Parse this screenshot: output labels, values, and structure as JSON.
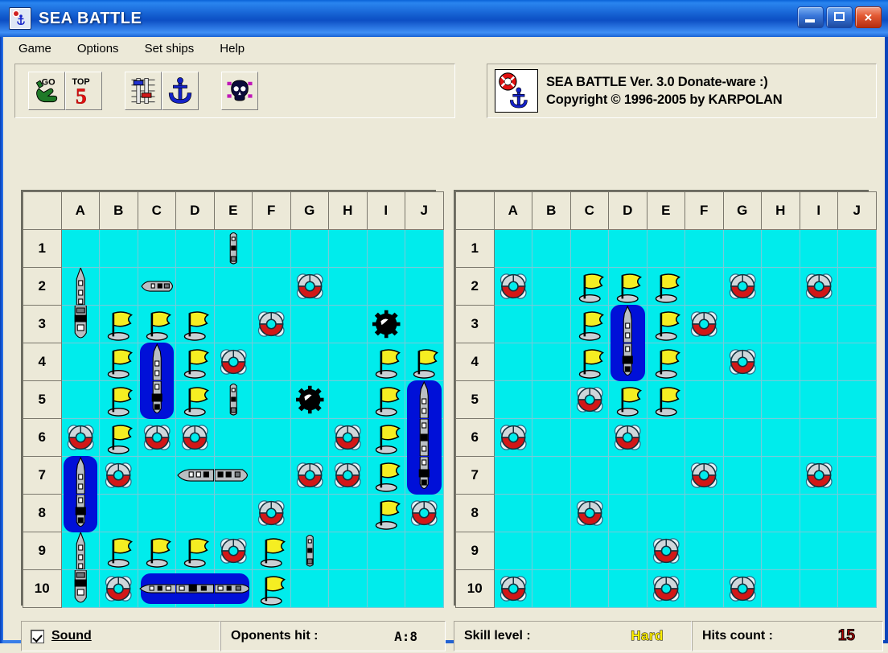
{
  "window": {
    "title": "SEA BATTLE",
    "icon": "seabattle-app-icon",
    "minimize_label": "",
    "maximize_label": "",
    "close_label": "✕"
  },
  "menu": {
    "items": [
      {
        "label": "Game"
      },
      {
        "label": "Options"
      },
      {
        "label": "Set ships"
      },
      {
        "label": "Help"
      }
    ]
  },
  "toolbar": {
    "buttons": [
      {
        "name": "go-button",
        "icon": "hand-go-icon",
        "label": "GO"
      },
      {
        "name": "top5-button",
        "icon": "top5-icon",
        "label": "TOP 5"
      },
      {
        "name": "options-button",
        "icon": "sliders-icon",
        "label": ""
      },
      {
        "name": "set-ships-button",
        "icon": "anchor-icon",
        "label": ""
      },
      {
        "name": "new-game-button",
        "icon": "skull-icon",
        "label": ""
      }
    ]
  },
  "about": {
    "icon": "lifering-anchor-icon",
    "line1": "SEA BATTLE Ver. 3.0  Donate-ware :)",
    "line2": "Copyright © 1996-2005 by KARPOLAN"
  },
  "boards": {
    "columns": [
      "A",
      "B",
      "C",
      "D",
      "E",
      "F",
      "G",
      "H",
      "I",
      "J"
    ],
    "rows": [
      "1",
      "2",
      "3",
      "4",
      "5",
      "6",
      "7",
      "8",
      "9",
      "10"
    ],
    "player": {
      "name": "player-board",
      "cells": [
        {
          "col": "E",
          "row": "1",
          "type": "ship",
          "shape": "small-vertical"
        },
        {
          "col": "A",
          "row": "2",
          "type": "ship",
          "shape": "tall-top"
        },
        {
          "col": "C",
          "row": "2",
          "type": "ship",
          "shape": "small-horizontal"
        },
        {
          "col": "G",
          "row": "2",
          "type": "hit"
        },
        {
          "col": "A",
          "row": "3",
          "type": "ship",
          "shape": "tall-bottom"
        },
        {
          "col": "B",
          "row": "3",
          "type": "miss"
        },
        {
          "col": "C",
          "row": "3",
          "type": "miss"
        },
        {
          "col": "D",
          "row": "3",
          "type": "miss"
        },
        {
          "col": "F",
          "row": "3",
          "type": "hit"
        },
        {
          "col": "I",
          "row": "3",
          "type": "mine"
        },
        {
          "col": "B",
          "row": "4",
          "type": "miss"
        },
        {
          "col": "C",
          "row": "4",
          "type": "sunk",
          "orient": "v-top"
        },
        {
          "col": "D",
          "row": "4",
          "type": "miss"
        },
        {
          "col": "E",
          "row": "4",
          "type": "hit"
        },
        {
          "col": "I",
          "row": "4",
          "type": "miss"
        },
        {
          "col": "J",
          "row": "4",
          "type": "miss"
        },
        {
          "col": "B",
          "row": "5",
          "type": "miss"
        },
        {
          "col": "C",
          "row": "5",
          "type": "sunk",
          "orient": "v-bot"
        },
        {
          "col": "D",
          "row": "5",
          "type": "miss"
        },
        {
          "col": "E",
          "row": "5",
          "type": "ship",
          "shape": "small-vertical"
        },
        {
          "col": "G",
          "row": "5",
          "type": "mine"
        },
        {
          "col": "I",
          "row": "5",
          "type": "miss"
        },
        {
          "col": "J",
          "row": "5",
          "type": "sunk",
          "orient": "v-top"
        },
        {
          "col": "A",
          "row": "6",
          "type": "hit"
        },
        {
          "col": "B",
          "row": "6",
          "type": "miss"
        },
        {
          "col": "C",
          "row": "6",
          "type": "hit"
        },
        {
          "col": "D",
          "row": "6",
          "type": "hit"
        },
        {
          "col": "H",
          "row": "6",
          "type": "hit"
        },
        {
          "col": "I",
          "row": "6",
          "type": "miss"
        },
        {
          "col": "J",
          "row": "6",
          "type": "sunk",
          "orient": "v-mid"
        },
        {
          "col": "A",
          "row": "7",
          "type": "sunk",
          "orient": "v-top"
        },
        {
          "col": "B",
          "row": "7",
          "type": "hit"
        },
        {
          "col": "D",
          "row": "7",
          "type": "ship",
          "shape": "long-horizontal"
        },
        {
          "col": "E",
          "row": "7",
          "type": "ship",
          "shape": "long-horizontal-tail"
        },
        {
          "col": "G",
          "row": "7",
          "type": "hit"
        },
        {
          "col": "H",
          "row": "7",
          "type": "hit"
        },
        {
          "col": "I",
          "row": "7",
          "type": "miss"
        },
        {
          "col": "J",
          "row": "7",
          "type": "sunk",
          "orient": "v-bot"
        },
        {
          "col": "A",
          "row": "8",
          "type": "sunk",
          "orient": "v-bot"
        },
        {
          "col": "F",
          "row": "8",
          "type": "hit"
        },
        {
          "col": "I",
          "row": "8",
          "type": "miss"
        },
        {
          "col": "J",
          "row": "8",
          "type": "hit"
        },
        {
          "col": "A",
          "row": "9",
          "type": "ship",
          "shape": "tall-top"
        },
        {
          "col": "B",
          "row": "9",
          "type": "miss"
        },
        {
          "col": "C",
          "row": "9",
          "type": "miss"
        },
        {
          "col": "D",
          "row": "9",
          "type": "miss"
        },
        {
          "col": "E",
          "row": "9",
          "type": "hit"
        },
        {
          "col": "F",
          "row": "9",
          "type": "miss"
        },
        {
          "col": "G",
          "row": "9",
          "type": "ship",
          "shape": "small-vertical"
        },
        {
          "col": "A",
          "row": "10",
          "type": "ship",
          "shape": "tall-bottom"
        },
        {
          "col": "B",
          "row": "10",
          "type": "hit"
        },
        {
          "col": "C",
          "row": "10",
          "type": "sunk",
          "orient": "h-left"
        },
        {
          "col": "D",
          "row": "10",
          "type": "sunk",
          "orient": "h-mid"
        },
        {
          "col": "E",
          "row": "10",
          "type": "sunk",
          "orient": "h-right"
        },
        {
          "col": "F",
          "row": "10",
          "type": "miss"
        }
      ]
    },
    "opponent": {
      "name": "opponent-board",
      "cells": [
        {
          "col": "A",
          "row": "2",
          "type": "hit"
        },
        {
          "col": "C",
          "row": "2",
          "type": "miss"
        },
        {
          "col": "D",
          "row": "2",
          "type": "miss"
        },
        {
          "col": "E",
          "row": "2",
          "type": "miss"
        },
        {
          "col": "G",
          "row": "2",
          "type": "hit"
        },
        {
          "col": "I",
          "row": "2",
          "type": "hit"
        },
        {
          "col": "C",
          "row": "3",
          "type": "miss"
        },
        {
          "col": "D",
          "row": "3",
          "type": "sunk",
          "orient": "v-top"
        },
        {
          "col": "E",
          "row": "3",
          "type": "miss"
        },
        {
          "col": "F",
          "row": "3",
          "type": "hit"
        },
        {
          "col": "C",
          "row": "4",
          "type": "miss"
        },
        {
          "col": "D",
          "row": "4",
          "type": "sunk",
          "orient": "v-bot"
        },
        {
          "col": "E",
          "row": "4",
          "type": "miss"
        },
        {
          "col": "G",
          "row": "4",
          "type": "hit"
        },
        {
          "col": "C",
          "row": "5",
          "type": "hit"
        },
        {
          "col": "D",
          "row": "5",
          "type": "miss"
        },
        {
          "col": "E",
          "row": "5",
          "type": "miss"
        },
        {
          "col": "A",
          "row": "6",
          "type": "hit"
        },
        {
          "col": "D",
          "row": "6",
          "type": "hit"
        },
        {
          "col": "F",
          "row": "7",
          "type": "hit"
        },
        {
          "col": "I",
          "row": "7",
          "type": "hit"
        },
        {
          "col": "C",
          "row": "8",
          "type": "hit"
        },
        {
          "col": "E",
          "row": "9",
          "type": "hit"
        },
        {
          "col": "A",
          "row": "10",
          "type": "hit"
        },
        {
          "col": "E",
          "row": "10",
          "type": "hit"
        },
        {
          "col": "G",
          "row": "10",
          "type": "hit"
        }
      ]
    }
  },
  "status": {
    "sound_label": "Sound",
    "sound_checked": true,
    "opponents_hit_label": "Oponents hit :",
    "opponents_hit_value": "A:8",
    "skill_level_label": "Skill level :",
    "skill_level_value": "Hard",
    "hits_count_label": "Hits count :",
    "hits_count_value": "15"
  },
  "colors": {
    "water": "#00ecec",
    "grid_line": "#79c9d8",
    "sunk_halo": "#0010d8",
    "flag": "#f5ee22",
    "hit_red": "#d21717",
    "face": "#ece9d8",
    "skill_text": "#ffee00",
    "hits_text": "#b50000"
  }
}
